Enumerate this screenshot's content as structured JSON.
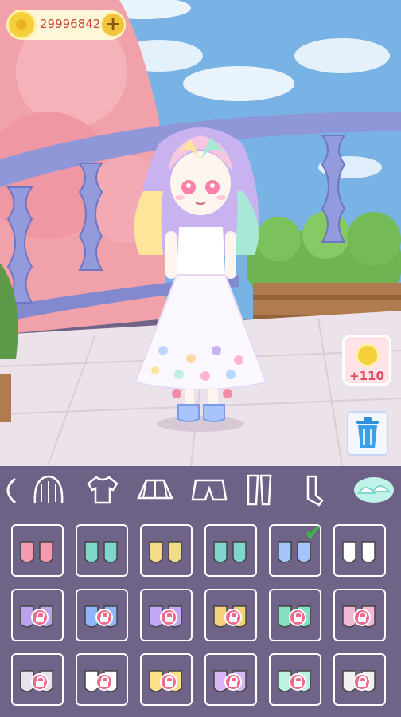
{
  "hud": {
    "coins": "29996842",
    "add_label": "+"
  },
  "reward": {
    "amount": "+110"
  },
  "categories": [
    {
      "icon": "headband-icon"
    },
    {
      "icon": "hair-icon"
    },
    {
      "icon": "shirt-icon"
    },
    {
      "icon": "skirt-icon"
    },
    {
      "icon": "shorts-icon"
    },
    {
      "icon": "legwear-icon"
    },
    {
      "icon": "socks-icon"
    },
    {
      "icon": "shoes-icon",
      "selected": true
    }
  ],
  "items": [
    {
      "name": "shoe-1",
      "color": "#f59ab0",
      "locked": false
    },
    {
      "name": "shoe-2",
      "color": "#7fd6cc",
      "locked": false
    },
    {
      "name": "shoe-3",
      "color": "#f2dc8a",
      "locked": false
    },
    {
      "name": "shoe-4",
      "color": "#7fd6cc",
      "locked": false
    },
    {
      "name": "shoe-5",
      "color": "#a8c4ff",
      "locked": false,
      "equipped": true
    },
    {
      "name": "shoe-6",
      "color": "#ffffff",
      "locked": false
    },
    {
      "name": "shoe-7",
      "color": "#b9a2f0",
      "locked": true
    },
    {
      "name": "shoe-8",
      "color": "#8fb5ff",
      "locked": true
    },
    {
      "name": "shoe-9",
      "color": "#c3a6f5",
      "locked": true
    },
    {
      "name": "shoe-10",
      "color": "#f4d27a",
      "locked": true
    },
    {
      "name": "shoe-11",
      "color": "#84e0c0",
      "locked": true
    },
    {
      "name": "shoe-12",
      "color": "#f3b8d6",
      "locked": true
    },
    {
      "name": "shoe-13",
      "color": "#e7e2ee",
      "locked": true
    },
    {
      "name": "shoe-14",
      "color": "#ffffff",
      "locked": true
    },
    {
      "name": "shoe-15",
      "color": "#ffe08a",
      "locked": true
    },
    {
      "name": "shoe-16",
      "color": "#d7b7f5",
      "locked": true
    },
    {
      "name": "shoe-17",
      "color": "#bff2de",
      "locked": true
    },
    {
      "name": "shoe-18",
      "color": "#f0f0f0",
      "locked": true
    }
  ],
  "colors": {
    "panel": "#6f6487",
    "accent": "#f06a8e",
    "check": "#3cb54a"
  }
}
